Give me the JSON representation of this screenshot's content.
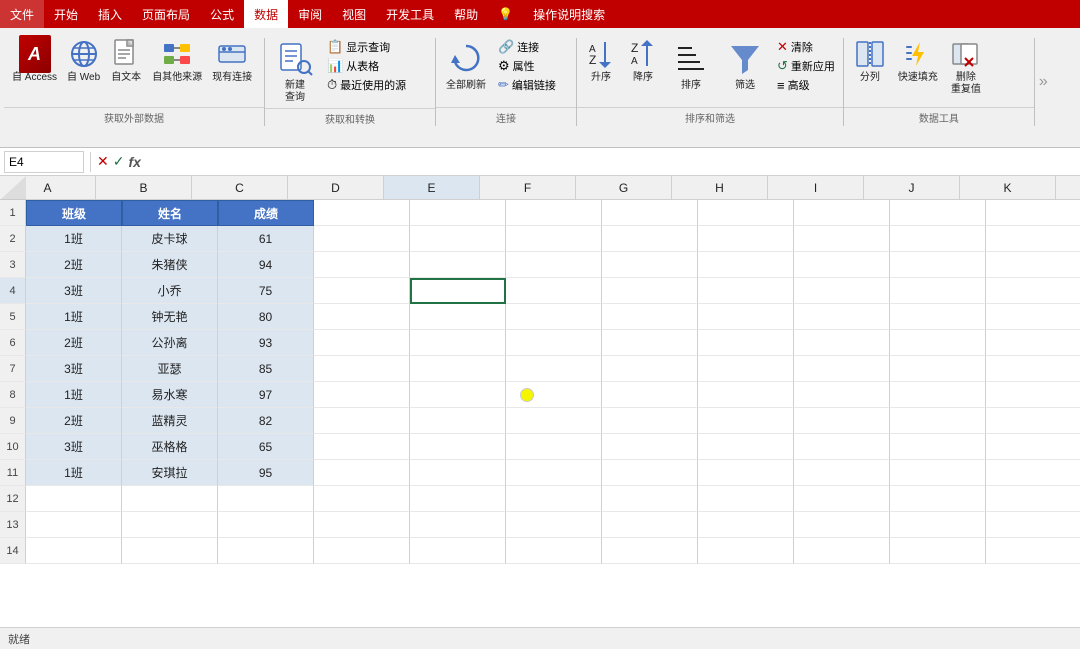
{
  "menu": {
    "items": [
      "文件",
      "开始",
      "插入",
      "页面布局",
      "公式",
      "数据",
      "审阅",
      "视图",
      "开发工具",
      "帮助",
      "操作说明搜索"
    ]
  },
  "ribbon": {
    "groups": [
      {
        "id": "external-data",
        "label": "获取外部数据",
        "buttons": [
          {
            "id": "access",
            "label": "自 Access",
            "icon": "A"
          },
          {
            "id": "web",
            "label": "自 Web",
            "icon": "🌐"
          },
          {
            "id": "text",
            "label": "自文本",
            "icon": "📄"
          },
          {
            "id": "other",
            "label": "自其他来源",
            "icon": "📊"
          },
          {
            "id": "existing",
            "label": "现有连接",
            "icon": "🔗"
          }
        ]
      },
      {
        "id": "get-transform",
        "label": "获取和转换",
        "buttons": [
          {
            "id": "new-query",
            "label": "新建\n查询",
            "icon": "🔍"
          },
          {
            "id": "show-query",
            "label": "显示查询",
            "icon": "📋"
          },
          {
            "id": "from-table",
            "label": "从表格",
            "icon": "📊"
          },
          {
            "id": "recent",
            "label": "最近使用的源",
            "icon": "⏱"
          }
        ]
      },
      {
        "id": "connections",
        "label": "连接",
        "buttons": [
          {
            "id": "refresh-all",
            "label": "全部刷新",
            "icon": "🔄"
          },
          {
            "id": "connections",
            "label": "连接",
            "icon": "🔗"
          },
          {
            "id": "properties",
            "label": "属性",
            "icon": "⚙"
          },
          {
            "id": "edit-links",
            "label": "编辑链接",
            "icon": "✏"
          }
        ]
      },
      {
        "id": "sort-filter",
        "label": "排序和筛选",
        "buttons": [
          {
            "id": "sort-az",
            "label": "升序",
            "icon": "↑"
          },
          {
            "id": "sort-za",
            "label": "降序",
            "icon": "↓"
          },
          {
            "id": "sort",
            "label": "排序",
            "icon": "⇅"
          },
          {
            "id": "filter",
            "label": "筛选",
            "icon": "▽"
          },
          {
            "id": "clear",
            "label": "清除",
            "icon": "✕"
          },
          {
            "id": "reapply",
            "label": "重新应用",
            "icon": "↺"
          },
          {
            "id": "advanced",
            "label": "高级",
            "icon": "≡"
          }
        ]
      },
      {
        "id": "data-tools",
        "label": "数据工具",
        "buttons": [
          {
            "id": "split",
            "label": "分列",
            "icon": "⫿"
          },
          {
            "id": "flash-fill",
            "label": "快速填充",
            "icon": "⚡"
          },
          {
            "id": "remove-dup",
            "label": "删除\n重复值",
            "icon": "🗑"
          }
        ]
      }
    ]
  },
  "formula_bar": {
    "cell_ref": "E4",
    "formula_placeholder": ""
  },
  "spreadsheet": {
    "columns": [
      "A",
      "B",
      "C",
      "D",
      "E",
      "F",
      "G",
      "H",
      "I",
      "J",
      "K"
    ],
    "selected_cell": "E4",
    "rows": [
      {
        "num": 1,
        "cells": [
          "班级",
          "姓名",
          "成绩",
          "",
          "",
          "",
          "",
          "",
          "",
          "",
          ""
        ]
      },
      {
        "num": 2,
        "cells": [
          "1班",
          "皮卡球",
          "61",
          "",
          "",
          "",
          "",
          "",
          "",
          "",
          ""
        ]
      },
      {
        "num": 3,
        "cells": [
          "2班",
          "朱猪侠",
          "94",
          "",
          "",
          "",
          "",
          "",
          "",
          "",
          ""
        ]
      },
      {
        "num": 4,
        "cells": [
          "3班",
          "小乔",
          "75",
          "",
          "",
          "",
          "",
          "",
          "",
          "",
          ""
        ]
      },
      {
        "num": 5,
        "cells": [
          "1班",
          "钟无艳",
          "80",
          "",
          "",
          "",
          "",
          "",
          "",
          "",
          ""
        ]
      },
      {
        "num": 6,
        "cells": [
          "2班",
          "公孙离",
          "93",
          "",
          "",
          "",
          "",
          "",
          "",
          "",
          ""
        ]
      },
      {
        "num": 7,
        "cells": [
          "3班",
          "亚瑟",
          "85",
          "",
          "",
          "",
          "",
          "",
          "",
          "",
          ""
        ]
      },
      {
        "num": 8,
        "cells": [
          "1班",
          "易水寒",
          "97",
          "",
          "",
          "",
          "",
          "",
          "",
          "",
          ""
        ]
      },
      {
        "num": 9,
        "cells": [
          "2班",
          "蓝精灵",
          "82",
          "",
          "",
          "",
          "",
          "",
          "",
          "",
          ""
        ]
      },
      {
        "num": 10,
        "cells": [
          "3班",
          "巫格格",
          "65",
          "",
          "",
          "",
          "",
          "",
          "",
          "",
          ""
        ]
      },
      {
        "num": 11,
        "cells": [
          "1班",
          "安琪拉",
          "95",
          "",
          "",
          "",
          "",
          "",
          "",
          "",
          ""
        ]
      },
      {
        "num": 12,
        "cells": [
          "",
          "",
          "",
          "",
          "",
          "",
          "",
          "",
          "",
          "",
          ""
        ]
      },
      {
        "num": 13,
        "cells": [
          "",
          "",
          "",
          "",
          "",
          "",
          "",
          "",
          "",
          "",
          ""
        ]
      },
      {
        "num": 14,
        "cells": [
          "",
          "",
          "",
          "",
          "",
          "",
          "",
          "",
          "",
          "",
          ""
        ]
      }
    ]
  },
  "status": "就绪"
}
